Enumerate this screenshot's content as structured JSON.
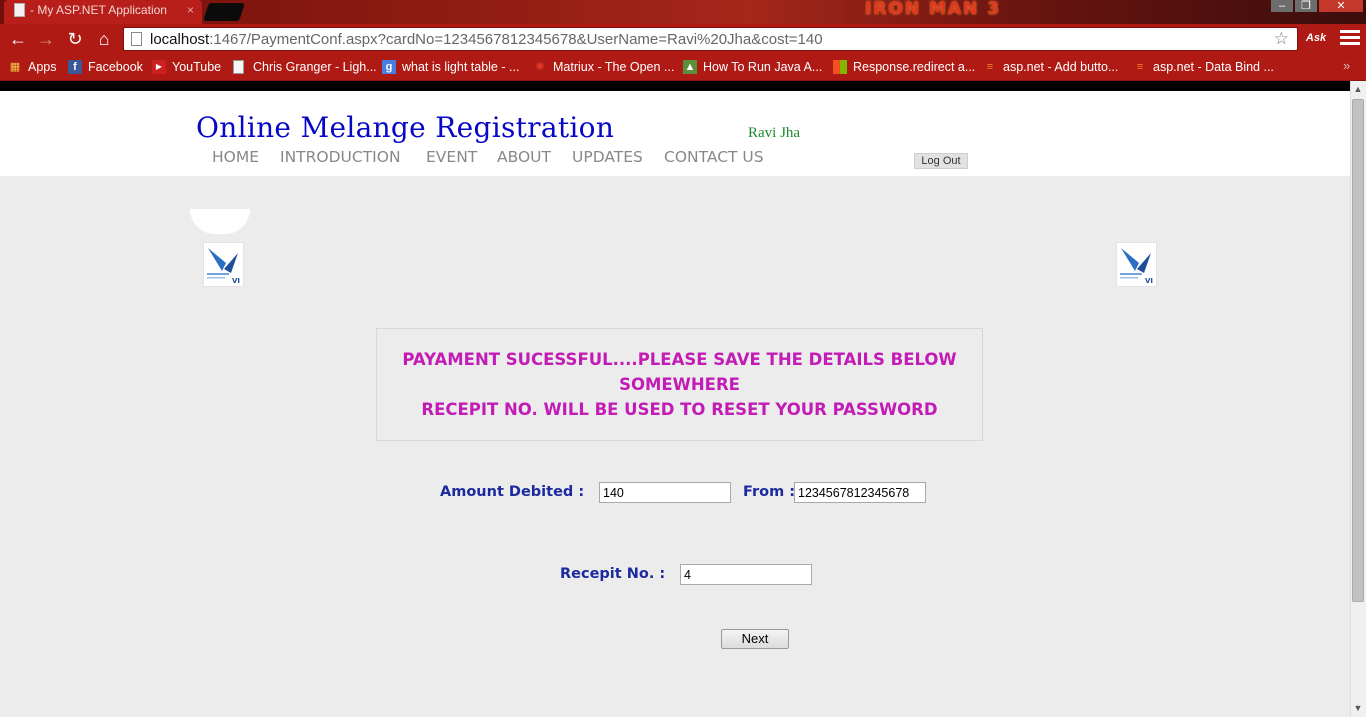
{
  "browser": {
    "tab_title": "- My ASP.NET Application",
    "tab_close": "×",
    "banner_text": "IRON MAN 3",
    "window_controls": {
      "minimize": "–",
      "maximize": "❐",
      "close": "✕"
    },
    "nav": {
      "back": "←",
      "forward": "→",
      "reload": "↻",
      "home": "⌂"
    },
    "url_host": "localhost",
    "url_rest": ":1467/PaymentConf.aspx?cardNo=1234567812345678&UserName=Ravi%20Jha&cost=140",
    "star": "☆",
    "ask_label": "Ask",
    "bookmarks": [
      {
        "label": "Apps",
        "icon": "apps-grid-icon"
      },
      {
        "label": "Facebook",
        "icon": "facebook-icon"
      },
      {
        "label": "YouTube",
        "icon": "youtube-icon"
      },
      {
        "label": "Chris Granger - Ligh...",
        "icon": "page-icon"
      },
      {
        "label": "what is light table - ...",
        "icon": "google-icon"
      },
      {
        "label": "Matriux - The Open ...",
        "icon": "matriux-icon"
      },
      {
        "label": "How To Run Java A...",
        "icon": "android-icon"
      },
      {
        "label": "Response.redirect a...",
        "icon": "windows-icon"
      },
      {
        "label": "asp.net - Add butto...",
        "icon": "stackoverflow-icon"
      },
      {
        "label": "asp.net - Data Bind ...",
        "icon": "stackoverflow-icon"
      }
    ],
    "bookmarks_more": "»"
  },
  "header": {
    "title": "Online Melange Registration",
    "user": "Ravi Jha",
    "logout_label": "Log Out",
    "menu": [
      "HOME",
      "INTRODUCTION",
      "EVENT",
      "ABOUT",
      "UPDATES",
      "CONTACT US"
    ]
  },
  "message": {
    "line1": "PAYAMENT SUCESSFUL....PLEASE SAVE THE DETAILS BELOW",
    "line2": "SOMEWHERE",
    "line3": "RECEPIT NO. WILL BE USED TO RESET YOUR PASSWORD"
  },
  "form": {
    "amount_label": "Amount Debited :",
    "amount_value": "140",
    "from_label": "From :",
    "from_value": "1234567812345678",
    "receipt_label": "Recepit No. :",
    "receipt_value": "4",
    "next_label": "Next"
  },
  "colors": {
    "browser_chrome": "#b01a15",
    "title": "#0707c8",
    "user": "#1c8a2a",
    "message": "#c21bb6",
    "labels": "#1b2a9e"
  }
}
